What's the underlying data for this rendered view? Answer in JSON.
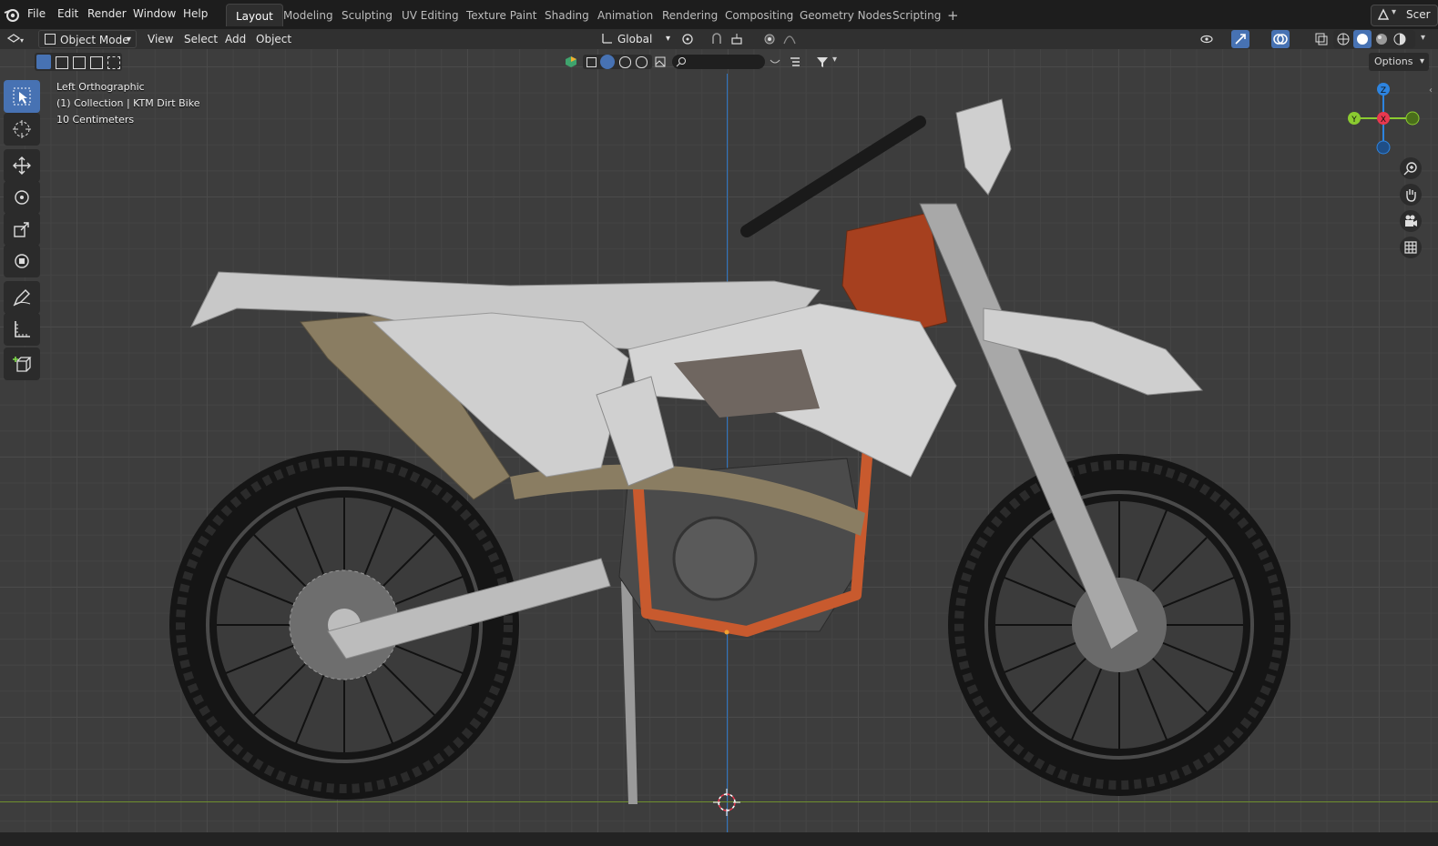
{
  "menubar": {
    "items": [
      "File",
      "Edit",
      "Render",
      "Window",
      "Help"
    ],
    "workspaces": [
      "Layout",
      "Modeling",
      "Sculpting",
      "UV Editing",
      "Texture Paint",
      "Shading",
      "Animation",
      "Rendering",
      "Compositing",
      "Geometry Nodes",
      "Scripting"
    ],
    "add_workspace": "+",
    "scene_label": "Scer"
  },
  "header": {
    "mode": "Object Mode",
    "view": "View",
    "select": "Select",
    "add": "Add",
    "object": "Object",
    "transform_orientation": "Global",
    "options": "Options"
  },
  "viewport": {
    "view_name": "Left Orthographic",
    "collection": "(1) Collection | KTM Dirt Bike",
    "grid_scale": "10 Centimeters",
    "gizmo": {
      "z": "Z",
      "y": "Y",
      "x": "X"
    }
  },
  "colors": {
    "axis_x": "#e8384f",
    "axis_y": "#8bcb30",
    "axis_z": "#2d84e0",
    "active_tool": "#4772b3",
    "frame": "#c85a2e"
  }
}
